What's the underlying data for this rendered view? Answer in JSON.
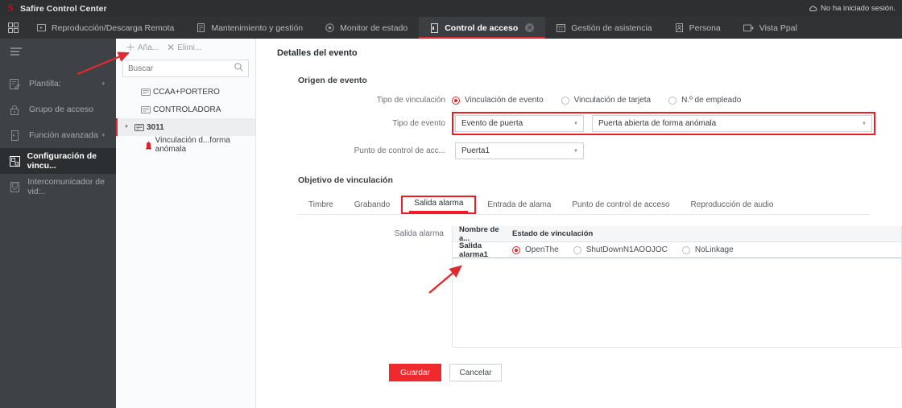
{
  "titlebar": {
    "app_title": "Safire Control Center",
    "login_status": "No ha iniciado sesión.",
    "cloud_icon": "cloud-icon",
    "logo": "S"
  },
  "navbar": {
    "grid_icon": "grid-menu-icon",
    "tabs": [
      {
        "label": "Reproducción/Descarga Remota",
        "icon": "playback-icon",
        "active": false,
        "closable": false
      },
      {
        "label": "Mantenimiento y gestión",
        "icon": "maintenance-icon",
        "active": false,
        "closable": false
      },
      {
        "label": "Monitor de estado",
        "icon": "status-monitor-icon",
        "active": false,
        "closable": false
      },
      {
        "label": "Control de acceso",
        "icon": "access-control-icon",
        "active": true,
        "closable": true
      },
      {
        "label": "Gestión de asistencia",
        "icon": "attendance-icon",
        "active": false,
        "closable": false
      },
      {
        "label": "Persona",
        "icon": "person-icon",
        "active": false,
        "closable": false
      },
      {
        "label": "Vista Ppal",
        "icon": "main-view-icon",
        "active": false,
        "closable": false
      }
    ]
  },
  "sidebar": {
    "hamburger_icon": "hamburger-icon",
    "items": [
      {
        "label": "Plantilla:",
        "icon": "template-icon",
        "caret": "▾",
        "active": false
      },
      {
        "label": "Grupo de acceso",
        "icon": "lock-icon",
        "caret": "",
        "active": false
      },
      {
        "label": "Función avanzada",
        "icon": "advanced-function-icon",
        "caret": "▾",
        "active": false
      },
      {
        "label": "Configuración de vincu...",
        "icon": "linkage-config-icon",
        "caret": "",
        "active": true
      },
      {
        "label": "Intercomunicador de vid:..",
        "icon": "video-intercom-icon",
        "caret": "",
        "active": false
      }
    ]
  },
  "tree_panel": {
    "toolbar": {
      "add_label": "Aña...",
      "add_icon": "plus-icon",
      "delete_label": "Elimi...",
      "delete_icon": "close-x-icon"
    },
    "search": {
      "placeholder": "Buscar",
      "icon": "search-icon"
    },
    "nodes": [
      {
        "label": "CCAA+PORTERO",
        "icon": "device-icon",
        "level": 0,
        "selected": false,
        "expander": ""
      },
      {
        "label": "CONTROLADORA",
        "icon": "device-icon",
        "level": 0,
        "selected": false,
        "expander": ""
      },
      {
        "label": "3011",
        "icon": "device-icon",
        "level": 0,
        "selected": true,
        "expander": "▼"
      },
      {
        "label": "Vinculación d...forma anómala",
        "icon": "alarm-siren-icon",
        "level": 1,
        "selected": false,
        "expander": ""
      }
    ]
  },
  "main": {
    "page_title": "Detalles del evento",
    "event_source": {
      "section_title": "Origen de evento",
      "linkage_type": {
        "label": "Tipo de vinculación",
        "options": [
          {
            "label": "Vinculación de evento",
            "selected": true
          },
          {
            "label": "Vinculación de tarjeta",
            "selected": false
          },
          {
            "label": "N.º de empleado",
            "selected": false
          }
        ]
      },
      "event_type": {
        "label": "Tipo de evento",
        "value_a": "Evento de puerta",
        "value_b": "Puerta abierta de forma anómala",
        "chevron": "▼"
      },
      "access_point": {
        "label": "Punto de control de acc...",
        "value": "Puerta1",
        "chevron": "▼"
      }
    },
    "linkage_target": {
      "section_title": "Objetivo de vinculación",
      "tabs": [
        {
          "label": "Timbre",
          "active": false
        },
        {
          "label": "Grabando",
          "active": false
        },
        {
          "label": "Salida alarma",
          "active": true
        },
        {
          "label": "Entrada de alama",
          "active": false
        },
        {
          "label": "Punto de control de acceso",
          "active": false
        },
        {
          "label": "Reproducción de audio",
          "active": false
        }
      ],
      "table": {
        "row_label": "Salida alarma",
        "headers": [
          "Nombre de a...",
          "Estado de vinculación"
        ],
        "rows": [
          {
            "name": "Salida alarma1",
            "states": [
              {
                "label": "OpenThe",
                "selected": true
              },
              {
                "label": "ShutDownN1AOOJOC",
                "selected": false
              },
              {
                "label": "NoLinkage",
                "selected": false
              }
            ]
          }
        ]
      }
    },
    "buttons": {
      "save": "Guardar",
      "cancel": "Cancelar"
    }
  },
  "annotations": {
    "arrow_color": "#e2292e",
    "highlight_color": "#ee1c25"
  }
}
